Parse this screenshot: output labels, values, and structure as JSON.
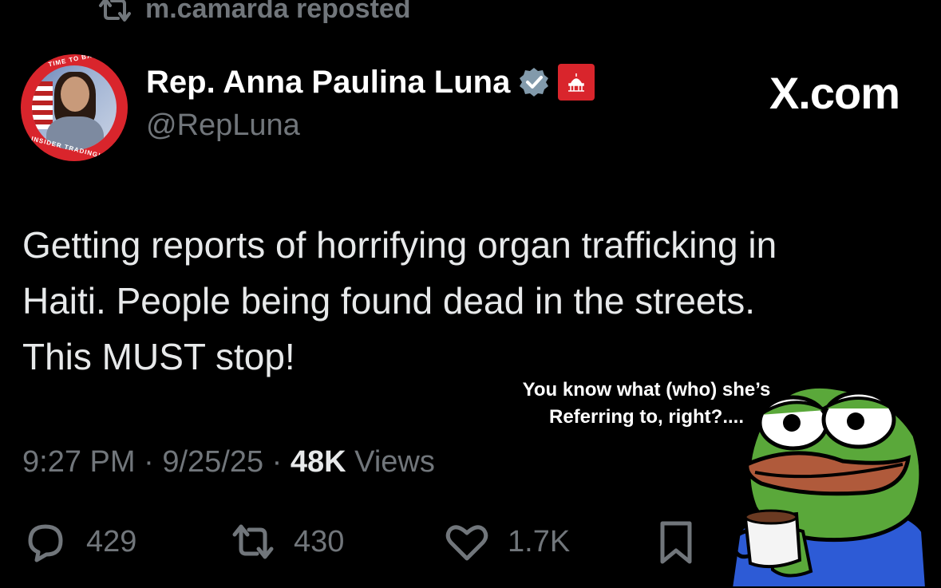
{
  "repost": {
    "text": "m.camarda reposted",
    "icon": "repost-icon"
  },
  "author": {
    "name": "Rep. Anna Paulina Luna",
    "handle": "@RepLuna",
    "avatar_ring_top": "TIME TO BAN",
    "avatar_ring_bottom": "INSIDER TRADING!"
  },
  "brand": "X.com",
  "tweet": {
    "lines": [
      "Getting reports of horrifying organ trafficking in",
      "Haiti. People being found dead in the streets.",
      "This MUST stop!"
    ]
  },
  "meta": {
    "time": "9:27 PM",
    "sep1": "·",
    "date": "9/25/25",
    "sep2": "·",
    "views_count": "48K",
    "views_label": "Views"
  },
  "actions": {
    "replies": "429",
    "reposts": "430",
    "likes": "1.7K"
  },
  "meme": {
    "caption_line1": "You know what (who) she’s",
    "caption_line2": "Referring to, right?...."
  },
  "colors": {
    "background": "#000000",
    "muted": "#71767b",
    "verified": "#829aab",
    "badge": "#d9252c"
  }
}
